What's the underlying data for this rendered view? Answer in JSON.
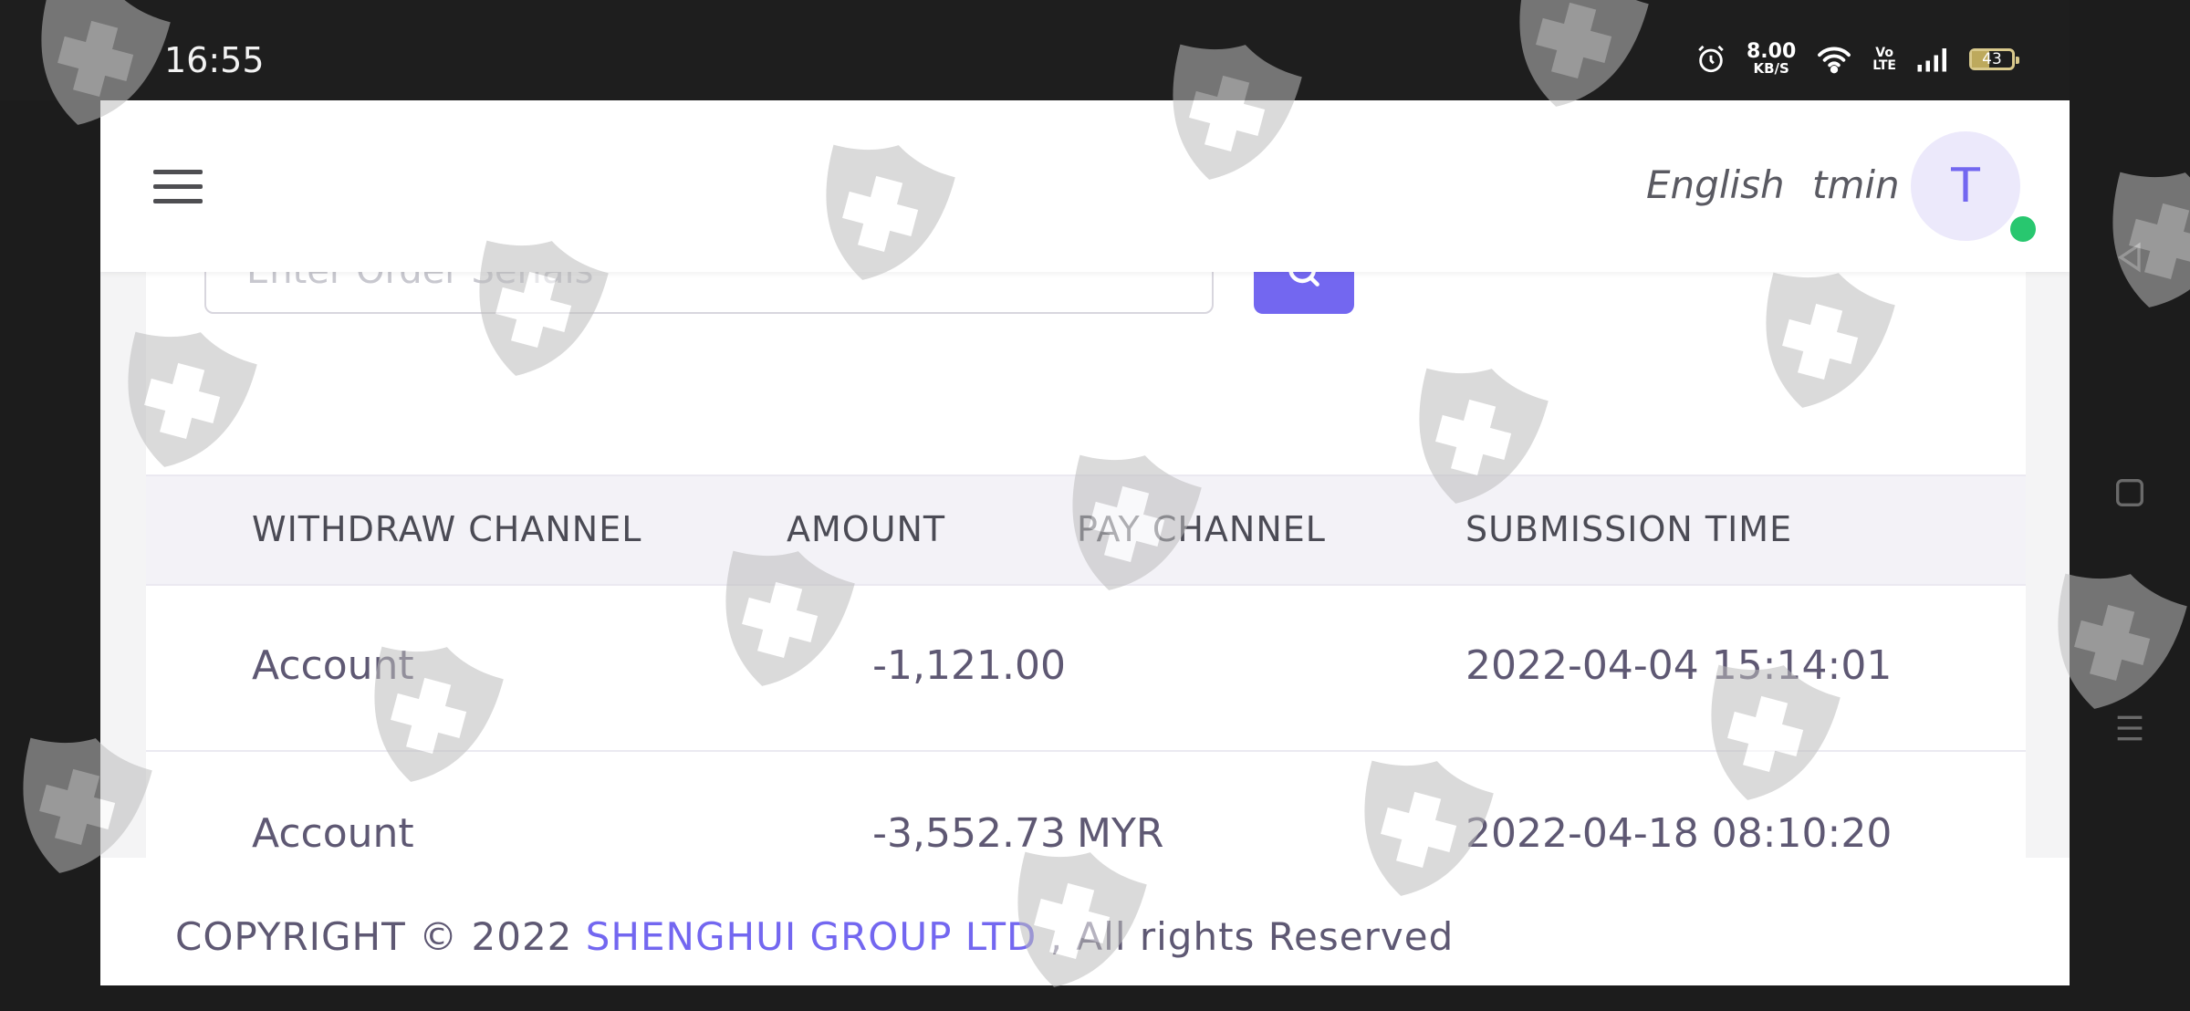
{
  "status_bar": {
    "time": "16:55",
    "net_speed_value": "8.00",
    "net_speed_unit": "KB/S",
    "volte_top": "Vo",
    "volte_bottom": "LTE",
    "battery": "43"
  },
  "header": {
    "language": "English",
    "username": "tmin",
    "avatar_initial": "T"
  },
  "search": {
    "placeholder": "Enter Order Serials"
  },
  "table": {
    "columns": [
      "WITHDRAW CHANNEL",
      "AMOUNT",
      "PAY CHANNEL",
      "SUBMISSION TIME"
    ],
    "rows": [
      {
        "withdraw_channel": "Account",
        "amount": "-1,121.00",
        "pay_channel": "",
        "submission_time": "2022-04-04 15:14:01"
      },
      {
        "withdraw_channel": "Account",
        "amount": "-3,552.73",
        "pay_channel": "MYR",
        "submission_time": "2022-04-18 08:10:20"
      }
    ]
  },
  "footer": {
    "prefix": "COPYRIGHT © 2022 ",
    "company": "SHENGHUI GROUP LTD",
    "suffix": " , All rights Reserved"
  },
  "colors": {
    "accent": "#7367f0",
    "online": "#28c76f",
    "status_bar": "#1e1e1e"
  }
}
